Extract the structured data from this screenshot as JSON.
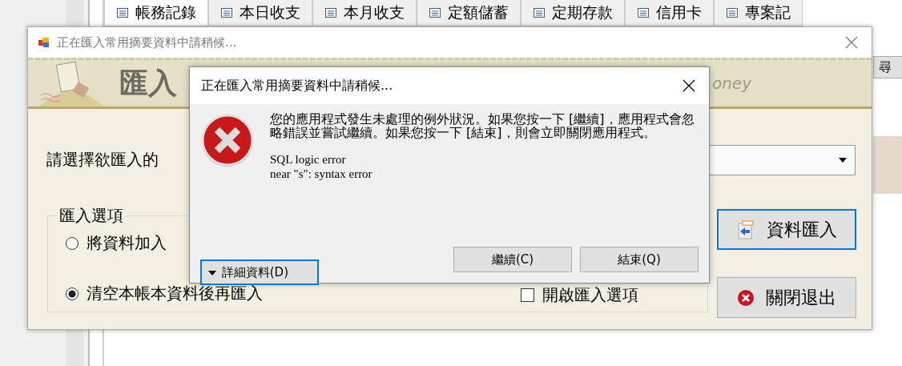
{
  "background_app": {
    "tabs": [
      {
        "label": "帳務記錄",
        "selected": true
      },
      {
        "label": "本日收支",
        "selected": false
      },
      {
        "label": "本月收支",
        "selected": false
      },
      {
        "label": "定額儲蓄",
        "selected": false
      },
      {
        "label": "定期存款",
        "selected": false
      },
      {
        "label": "信用卡",
        "selected": false
      },
      {
        "label": "專案記",
        "selected": false
      }
    ],
    "side_button": "尋"
  },
  "window": {
    "title": "正在匯入常用摘要資料中請稍候...",
    "banner_title": "匯入",
    "banner_tagline": "oney",
    "source_label": "請選擇欲匯入的",
    "options_group": {
      "title": "匯入選項",
      "radios": [
        {
          "label": "將資料加入",
          "selected": false
        },
        {
          "label": "清空本帳本資料後再匯入",
          "selected": true
        }
      ],
      "checkbox": {
        "label": "開啟匯入選項",
        "checked": false
      }
    },
    "buttons": [
      {
        "label": "資料匯入",
        "kind": "import",
        "focused": true
      },
      {
        "label": "關閉退出",
        "kind": "close",
        "focused": false
      }
    ]
  },
  "dialog": {
    "title": "正在匯入常用摘要資料中請稍候...",
    "message": "您的應用程式發生未處理的例外狀況。如果您按一下 [繼續]，應用程式會忽略錯誤並嘗試繼續。如果您按一下 [結束]，則會立即關閉應用程式。",
    "details": [
      "SQL logic error",
      "near \"s\": syntax error"
    ],
    "buttons": [
      {
        "label": "詳細資料(D)",
        "kind": "details",
        "focused": true
      },
      {
        "label": "繼續(C)",
        "kind": "plain",
        "focused": false
      },
      {
        "label": "結束(Q)",
        "kind": "plain",
        "focused": false
      }
    ]
  }
}
